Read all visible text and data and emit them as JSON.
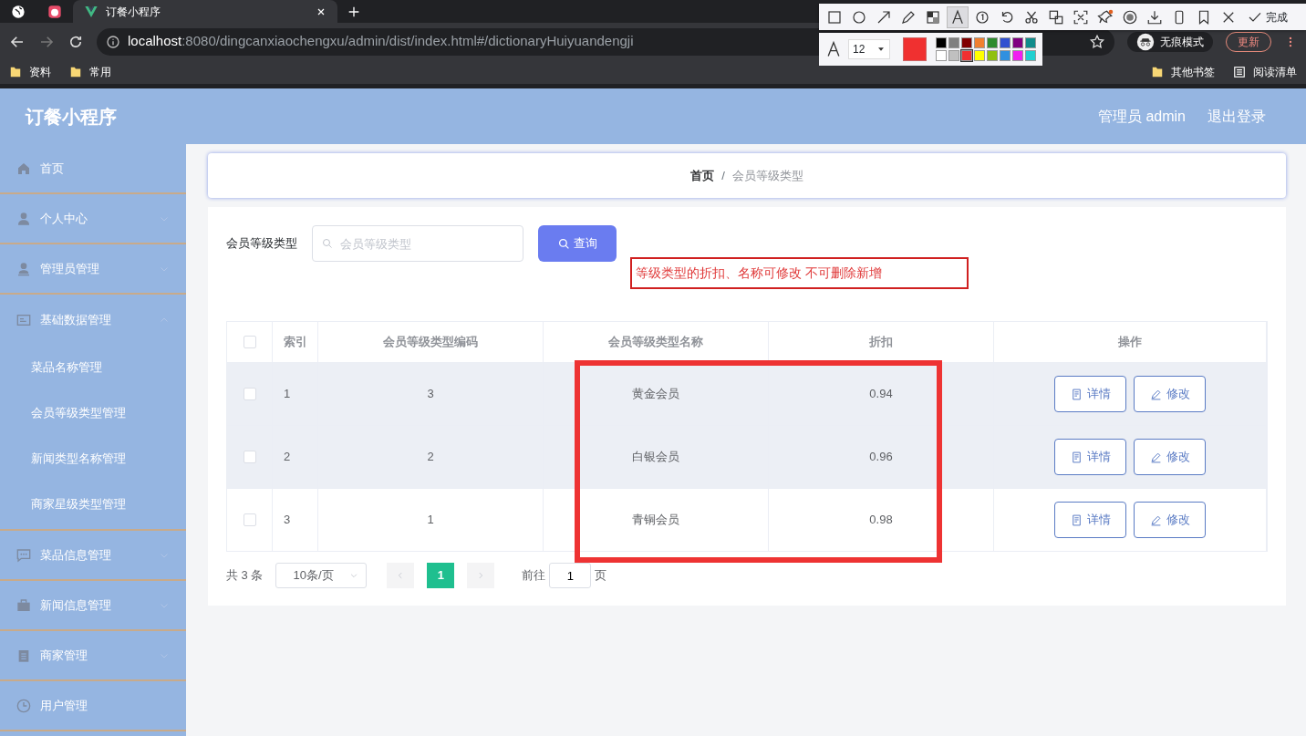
{
  "browser": {
    "tabs": [
      {
        "kind": "globe",
        "selected": false
      },
      {
        "kind": "app",
        "selected": false
      },
      {
        "kind": "vue",
        "label": "订餐小程序",
        "selected": true
      }
    ],
    "url_host": "localhost",
    "url_path": ":8080/dingcanxiaochengxu/admin/dist/index.html#/dictionaryHuiyuandengji",
    "bookmarks": [
      "资料",
      "常用"
    ],
    "bookmarks_right": [
      "其他书签",
      "阅读清单"
    ],
    "incognito": "无痕模式",
    "update": "更新"
  },
  "annotation_toolbar": {
    "tools": [
      {
        "kind": "rect",
        "selected": false
      },
      {
        "kind": "circle",
        "selected": false
      },
      {
        "kind": "arrow",
        "selected": false
      },
      {
        "kind": "pen",
        "selected": false
      },
      {
        "kind": "mosaic",
        "selected": false
      },
      {
        "kind": "text",
        "selected": true
      },
      {
        "kind": "number",
        "selected": false
      },
      {
        "kind": "undo",
        "selected": false
      },
      {
        "kind": "cut",
        "selected": false
      },
      {
        "kind": "translate",
        "selected": false
      },
      {
        "kind": "ocr",
        "selected": false
      },
      {
        "kind": "pin",
        "selected": false
      },
      {
        "kind": "record",
        "selected": false
      },
      {
        "kind": "download",
        "selected": false
      },
      {
        "kind": "phone",
        "selected": false
      },
      {
        "kind": "bookmark",
        "selected": false
      },
      {
        "kind": "close",
        "selected": false
      }
    ],
    "done": "完成",
    "font_size": "12",
    "palette": [
      {
        "color": "#000000"
      },
      {
        "color": "#808080"
      },
      {
        "color": "#800000"
      },
      {
        "color": "#f08030"
      },
      {
        "color": "#2e8b2e"
      },
      {
        "color": "#3050d0"
      },
      {
        "color": "#800080"
      },
      {
        "color": "#108c8c"
      },
      {
        "color": "#ffffff"
      },
      {
        "color": "#c0c0c0"
      },
      {
        "color": "#f03030",
        "selected": true
      },
      {
        "color": "#ffff00"
      },
      {
        "color": "#90c010"
      },
      {
        "color": "#3090e0"
      },
      {
        "color": "#f020f0"
      },
      {
        "color": "#20d0d0"
      }
    ]
  },
  "header": {
    "title": "订餐小程序",
    "user": "管理员 admin",
    "logout": "退出登录"
  },
  "sidebar": {
    "items": [
      {
        "kind": "home",
        "label": "首页"
      },
      {
        "kind": "person",
        "label": "个人中心",
        "expanded": false
      },
      {
        "kind": "admin",
        "label": "管理员管理",
        "expanded": false
      },
      {
        "kind": "card",
        "label": "基础数据管理",
        "expanded": true,
        "children": [
          {
            "label": "菜品名称管理"
          },
          {
            "label": "会员等级类型管理"
          },
          {
            "label": "新闻类型名称管理"
          },
          {
            "label": "商家星级类型管理"
          }
        ]
      },
      {
        "kind": "chat",
        "label": "菜品信息管理",
        "expanded": false
      },
      {
        "kind": "case",
        "label": "新闻信息管理",
        "expanded": false
      },
      {
        "kind": "clip",
        "label": "商家管理",
        "expanded": false
      },
      {
        "kind": "clock",
        "label": "用户管理"
      }
    ]
  },
  "breadcrumb": [
    "首页",
    "会员等级类型"
  ],
  "breadcrumb_separator": "/",
  "search": {
    "label": "会员等级类型",
    "placeholder": "会员等级类型",
    "button": "查询"
  },
  "annotation_note": "等级类型的折扣、名称可修改 不可删除新增",
  "table": {
    "select_all_checked": false,
    "columns": [
      "索引",
      "会员等级类型编码",
      "会员等级类型名称",
      "折扣",
      "操作"
    ],
    "rows": [
      {
        "checked": false,
        "highlighted": true,
        "cells": [
          "1",
          "3",
          "黄金会员",
          "0.94"
        ],
        "actions": [
          "详情",
          "修改"
        ]
      },
      {
        "checked": false,
        "highlighted": true,
        "cells": [
          "2",
          "2",
          "白银会员",
          "0.96"
        ],
        "actions": [
          "详情",
          "修改"
        ]
      },
      {
        "checked": false,
        "highlighted": false,
        "cells": [
          "3",
          "1",
          "青铜会员",
          "0.98"
        ],
        "actions": [
          "详情",
          "修改"
        ]
      }
    ]
  },
  "pagination": {
    "total": "共 3 条",
    "page_size": "10条/页",
    "pages": [
      {
        "label": "1",
        "selected": true
      }
    ],
    "goto": "前往",
    "goto_value": "1",
    "page_unit": "页"
  }
}
